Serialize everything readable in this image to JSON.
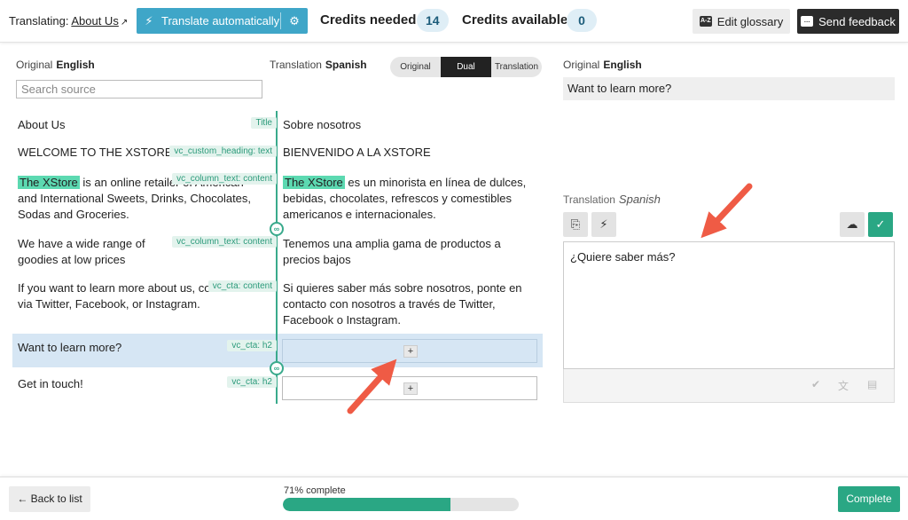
{
  "header": {
    "translating_label": "Translating:",
    "page_link": "About Us",
    "auto_translate_label": "Translate automatically",
    "credits_needed_label": "Credits needed",
    "credits_needed": "14",
    "credits_available_label": "Credits available",
    "credits_available": "0",
    "glossary_label": "Edit glossary",
    "feedback_label": "Send feedback"
  },
  "source_header": {
    "label": "Original",
    "language": "English"
  },
  "target_header": {
    "label": "Translation",
    "language": "Spanish"
  },
  "search_placeholder": "Search source",
  "view_toggle": {
    "options": [
      "Original",
      "Dual",
      "Translation"
    ],
    "selected": "Dual"
  },
  "rows": [
    {
      "source": "About Us",
      "tag": "Title",
      "target": "Sobre nosotros"
    },
    {
      "source": "WELCOME TO THE XSTORE",
      "tag": "vc_custom_heading: text",
      "target": "BIENVENIDO A LA XSTORE"
    },
    {
      "source_highlight": "The XStore",
      "source": " is an online retailer of American and International Sweets, Drinks, Chocolates, Sodas and Groceries.",
      "tag": "vc_column_text: content",
      "target_highlight": "The XStore",
      "target": " es un minorista en línea de dulces, bebidas, chocolates, refrescos y comestibles americanos e internacionales."
    },
    {
      "source": "We have a wide range of goodies at low prices",
      "tag": "vc_column_text: content",
      "target": "Tenemos una amplia gama de productos a precios bajos"
    },
    {
      "source": "If you want to learn more about us, contact us via Twitter, Facebook, or Instagram.",
      "tag": "vc_cta: content",
      "target": "Si quieres saber más sobre nosotros, ponte en contacto con nosotros a través de Twitter, Facebook o Instagram."
    },
    {
      "source": "Want to learn more?",
      "tag": "vc_cta: h2",
      "target": ""
    },
    {
      "source": "Get in touch!",
      "tag": "vc_cta: h2",
      "target": ""
    }
  ],
  "plus_label": "+",
  "right_panel": {
    "original_label": "Original",
    "original_language": "English",
    "original_text": "Want to learn more?",
    "translation_label": "Translation",
    "translation_language": "Spanish",
    "translation_text": "¿Quiere saber más?"
  },
  "footer": {
    "back_label": "← Back to list",
    "progress_label": "71% complete",
    "progress": 0.71,
    "complete_label": "Complete"
  },
  "colors": {
    "accent": "#3fa6c8",
    "green": "#2aa784",
    "highlight": "#5cd9b1",
    "arrow": "#ef5b45"
  }
}
